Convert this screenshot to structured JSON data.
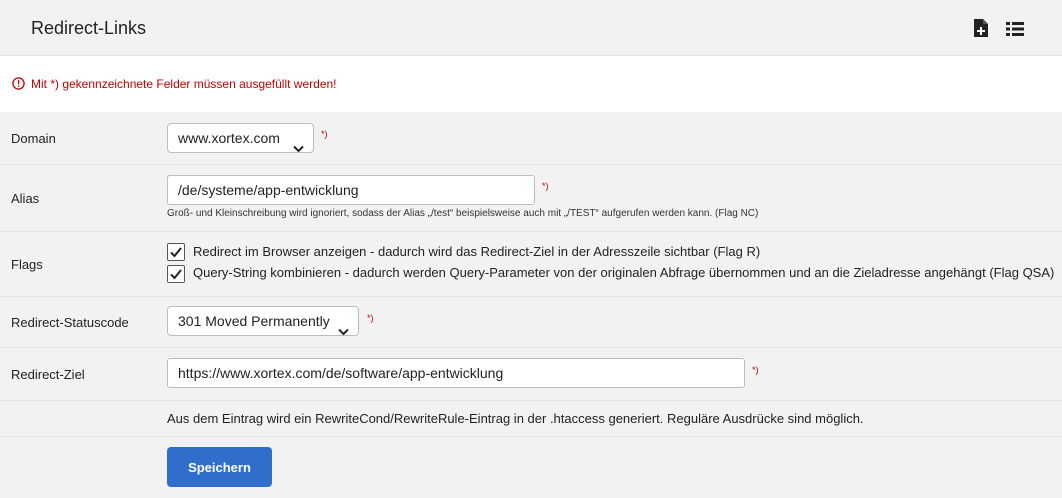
{
  "header": {
    "title": "Redirect-Links",
    "icons": [
      "add-document-icon",
      "list-icon"
    ]
  },
  "notice": {
    "text": "Mit *) gekennzeichnete Felder müssen ausgefüllt werden!",
    "icon": "exclamation-circle-icon"
  },
  "form": {
    "required_marker": "*)",
    "domain": {
      "label": "Domain",
      "value": "www.xortex.com"
    },
    "alias": {
      "label": "Alias",
      "value": "/de/systeme/app-entwicklung",
      "hint": "Groß- und Kleinschreibung wird ignoriert, sodass der Alias „/test“ beispielsweise auch mit „/TEST“ aufgerufen werden kann. (Flag NC)"
    },
    "flags": {
      "label": "Flags",
      "options": [
        {
          "label": "Redirect im Browser anzeigen - dadurch wird das Redirect-Ziel in der Adresszeile sichtbar (Flag R)",
          "checked": true
        },
        {
          "label": "Query-String kombinieren - dadurch werden Query-Parameter von der originalen Abfrage übernommen und an die Zieladresse angehängt (Flag QSA)",
          "checked": true
        }
      ]
    },
    "statuscode": {
      "label": "Redirect-Statuscode",
      "value": "301 Moved Permanently"
    },
    "target": {
      "label": "Redirect-Ziel",
      "value": "https://www.xortex.com/de/software/app-entwicklung"
    },
    "info": "Aus dem Eintrag wird ein RewriteCond/RewriteRule-Eintrag in der .htaccess generiert. Reguläre Ausdrücke sind möglich.",
    "submit_label": "Speichern"
  },
  "colors": {
    "accent": "#2f6fcb",
    "required": "#c00000",
    "background": "#f2f2f2"
  }
}
